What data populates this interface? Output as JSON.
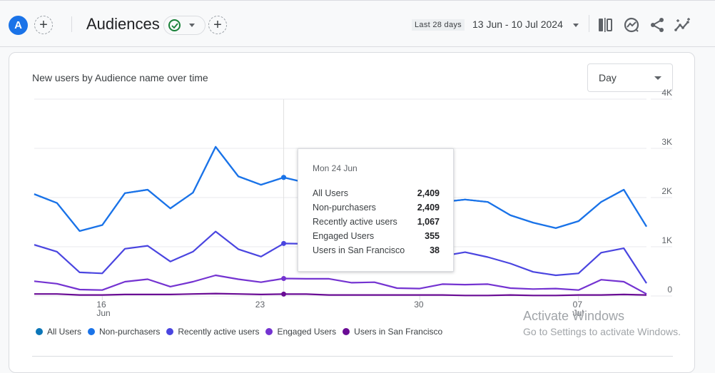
{
  "topbar": {
    "avatar_letter": "A",
    "add_comparison_label": "+",
    "report_title": "Audiences",
    "add_report_label": "+",
    "date_preset": "Last 28 days",
    "date_range": "13 Jun - 10 Jul 2024",
    "icons": [
      "compare-icon",
      "insights-icon",
      "share-icon",
      "sparkle-trend-icon"
    ]
  },
  "card": {
    "title": "New users by Audience name over time",
    "granularity_select": "Day"
  },
  "tooltip": {
    "date": "Mon 24 Jun",
    "rows": [
      {
        "label": "All Users",
        "value": "2,409"
      },
      {
        "label": "Non-purchasers",
        "value": "2,409"
      },
      {
        "label": "Recently active users",
        "value": "1,067"
      },
      {
        "label": "Engaged Users",
        "value": "355"
      },
      {
        "label": "Users in San Francisco",
        "value": "38"
      }
    ]
  },
  "watermark": {
    "line1": "Activate Windows",
    "line2": "Go to Settings to activate Windows."
  },
  "chart_data": {
    "type": "line",
    "title": "New users by Audience name over time",
    "xlabel": "",
    "ylabel": "",
    "ylim": [
      0,
      4000
    ],
    "y_ticks": [
      "0",
      "1K",
      "2K",
      "3K",
      "4K"
    ],
    "x_tick_labels": [
      {
        "index": 3,
        "line1": "16",
        "line2": "Jun"
      },
      {
        "index": 10,
        "line1": "23",
        "line2": ""
      },
      {
        "index": 17,
        "line1": "30",
        "line2": ""
      },
      {
        "index": 24,
        "line1": "07",
        "line2": "Jul"
      }
    ],
    "highlight_index": 11,
    "grid": true,
    "legend_position": "bottom-left",
    "x": [
      "13 Jun",
      "14 Jun",
      "15 Jun",
      "16 Jun",
      "17 Jun",
      "18 Jun",
      "19 Jun",
      "20 Jun",
      "21 Jun",
      "22 Jun",
      "23 Jun",
      "24 Jun",
      "25 Jun",
      "26 Jun",
      "27 Jun",
      "28 Jun",
      "29 Jun",
      "30 Jun",
      "01 Jul",
      "02 Jul",
      "03 Jul",
      "04 Jul",
      "05 Jul",
      "06 Jul",
      "07 Jul",
      "08 Jul",
      "09 Jul",
      "10 Jul"
    ],
    "series": [
      {
        "name": "All Users",
        "color": "#1a73e8",
        "values": [
          2070,
          1890,
          1320,
          1440,
          2090,
          2160,
          1780,
          2100,
          3030,
          2430,
          2260,
          2409,
          2300,
          2100,
          1590,
          1440,
          1440,
          1670,
          1910,
          1960,
          1910,
          1640,
          1490,
          1380,
          1520,
          1910,
          2160,
          1410
        ]
      },
      {
        "name": "Non-purchasers",
        "color": "#1a73e8",
        "values": [
          2070,
          1890,
          1320,
          1440,
          2090,
          2160,
          1780,
          2100,
          3030,
          2430,
          2260,
          2409,
          2300,
          2100,
          1590,
          1440,
          1440,
          1670,
          1910,
          1960,
          1910,
          1640,
          1490,
          1380,
          1520,
          1910,
          2160,
          1410
        ]
      },
      {
        "name": "Recently active users",
        "color": "#4a45e0",
        "values": [
          1040,
          900,
          480,
          460,
          960,
          1020,
          700,
          900,
          1310,
          950,
          800,
          1067,
          1060,
          900,
          620,
          550,
          560,
          830,
          810,
          890,
          790,
          660,
          490,
          420,
          460,
          880,
          970,
          260
        ]
      },
      {
        "name": "Engaged Users",
        "color": "#7433d1",
        "values": [
          300,
          250,
          130,
          120,
          290,
          340,
          190,
          290,
          420,
          340,
          280,
          355,
          350,
          350,
          270,
          280,
          160,
          150,
          240,
          230,
          240,
          160,
          140,
          150,
          120,
          330,
          290,
          40
        ]
      },
      {
        "name": "Users in San Francisco",
        "color": "#6a0c95",
        "values": [
          40,
          40,
          20,
          20,
          30,
          30,
          30,
          40,
          50,
          40,
          30,
          38,
          38,
          20,
          20,
          20,
          20,
          20,
          20,
          10,
          10,
          20,
          10,
          10,
          20,
          20,
          30,
          20
        ]
      }
    ],
    "legend": [
      {
        "name": "All Users",
        "color": "#0b76b8"
      },
      {
        "name": "Non-purchasers",
        "color": "#1a73e8"
      },
      {
        "name": "Recently active users",
        "color": "#4a45e0"
      },
      {
        "name": "Engaged Users",
        "color": "#7433d1"
      },
      {
        "name": "Users in San Francisco",
        "color": "#6a0c95"
      }
    ]
  }
}
